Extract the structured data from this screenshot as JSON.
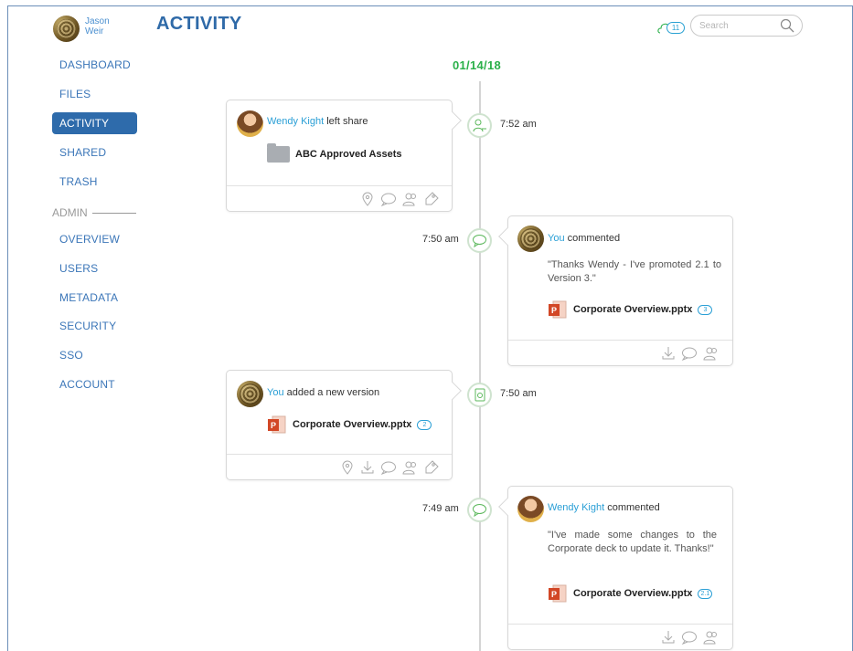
{
  "user": {
    "name": "Jason Weir"
  },
  "header": {
    "title": "ACTIVITY",
    "notification_count": "11",
    "search_placeholder": "Search"
  },
  "sidebar": {
    "items": [
      {
        "label": "DASHBOARD"
      },
      {
        "label": "FILES"
      },
      {
        "label": "ACTIVITY",
        "active": true
      },
      {
        "label": "SHARED"
      },
      {
        "label": "TRASH"
      }
    ],
    "admin_label": "ADMIN",
    "admin_items": [
      {
        "label": "OVERVIEW"
      },
      {
        "label": "USERS"
      },
      {
        "label": "METADATA"
      },
      {
        "label": "SECURITY"
      },
      {
        "label": "SSO"
      },
      {
        "label": "ACCOUNT"
      }
    ]
  },
  "timeline": {
    "date": "01/14/18",
    "events": [
      {
        "time": "7:52 am",
        "actor": "Wendy Kight",
        "action": "left share",
        "file": "ABC Approved Assets"
      },
      {
        "time": "7:50 am",
        "actor": "You",
        "action": "commented",
        "comment": "\"Thanks Wendy - I've promoted 2.1 to Version 3.\"",
        "file": "Corporate Overview.pptx",
        "version": "3"
      },
      {
        "time": "7:50 am",
        "actor": "You",
        "action": "added a new version",
        "file": "Corporate Overview.pptx",
        "version": "2"
      },
      {
        "time": "7:49 am",
        "actor": "Wendy Kight",
        "action": "commented",
        "comment": "\"I've made some changes to the Corporate deck to update it. Thanks!\"",
        "file": "Corporate Overview.pptx",
        "version": "2.1"
      }
    ]
  },
  "colors": {
    "brand": "#2e6bab",
    "link": "#2a9fd6",
    "date": "#2bb04a"
  }
}
